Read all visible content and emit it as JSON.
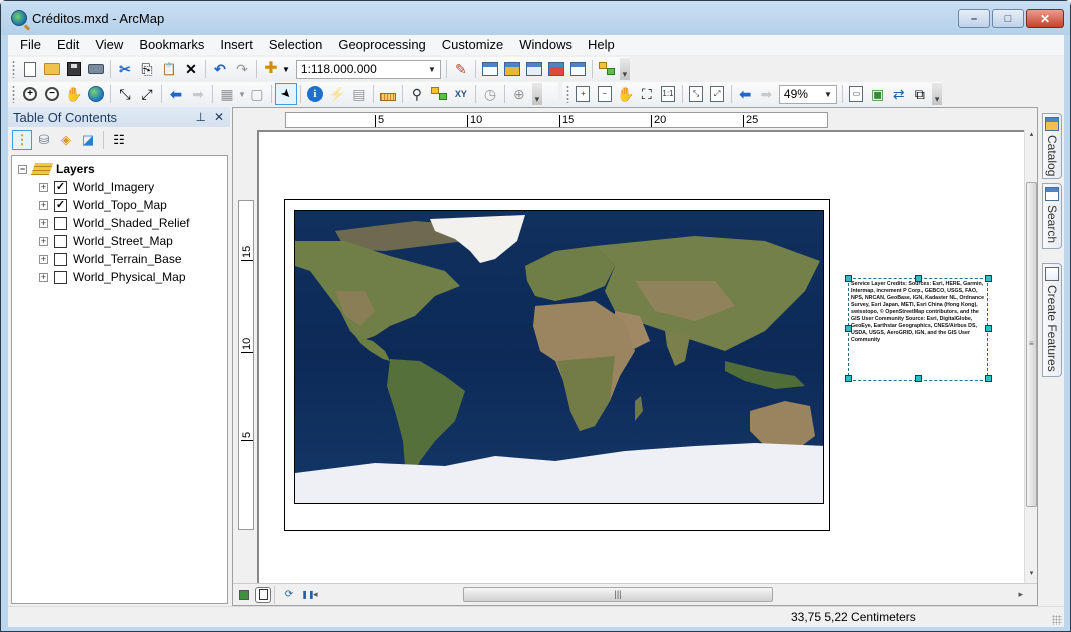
{
  "window": {
    "title": "Créditos.mxd - ArcMap",
    "controls": {
      "minimize": "–",
      "maximize": "□",
      "close": "✕"
    }
  },
  "menu": [
    "File",
    "Edit",
    "View",
    "Bookmarks",
    "Insert",
    "Selection",
    "Geoprocessing",
    "Customize",
    "Windows",
    "Help"
  ],
  "standard_toolbar": {
    "buttons": [
      {
        "name": "new-document",
        "icon": "new-document-icon"
      },
      {
        "name": "open",
        "icon": "open-folder-icon"
      },
      {
        "name": "save",
        "icon": "save-icon"
      },
      {
        "name": "print",
        "icon": "print-icon"
      },
      {
        "name": "cut",
        "icon": "scissors-icon",
        "glyph": "✂"
      },
      {
        "name": "copy",
        "icon": "copy-icon",
        "glyph": "⎘"
      },
      {
        "name": "paste",
        "icon": "paste-icon",
        "glyph": "📋"
      },
      {
        "name": "delete",
        "icon": "delete-icon",
        "glyph": "✕"
      },
      {
        "name": "undo",
        "icon": "undo-icon",
        "glyph": "↶"
      },
      {
        "name": "redo",
        "icon": "redo-icon",
        "glyph": "↷"
      },
      {
        "name": "add-data",
        "icon": "add-data-icon",
        "glyph": "✚"
      }
    ],
    "scale": "1:118.000.000",
    "right_buttons": [
      {
        "name": "editor-toolbar",
        "icon": "editor-pencil-icon",
        "glyph": "✎"
      },
      {
        "name": "table-of-contents",
        "icon": "toc-window-icon"
      },
      {
        "name": "catalog-window",
        "icon": "catalog-window-icon"
      },
      {
        "name": "search-window",
        "icon": "search-window-icon"
      },
      {
        "name": "arctoolbox",
        "icon": "arctoolbox-icon"
      },
      {
        "name": "python-window",
        "icon": "python-window-icon",
        "glyph": "›"
      },
      {
        "name": "modelbuilder",
        "icon": "modelbuilder-icon"
      }
    ]
  },
  "tools_toolbar": {
    "buttons": [
      {
        "name": "zoom-in",
        "icon": "zoom-in-icon",
        "glyph": "+"
      },
      {
        "name": "zoom-out",
        "icon": "zoom-out-icon",
        "glyph": "−"
      },
      {
        "name": "pan",
        "icon": "pan-hand-icon",
        "glyph": "✋"
      },
      {
        "name": "full-extent",
        "icon": "globe-icon"
      },
      {
        "name": "fixed-zoom-in",
        "icon": "fixed-zoom-in-icon",
        "glyph": "⤡"
      },
      {
        "name": "fixed-zoom-out",
        "icon": "fixed-zoom-out-icon",
        "glyph": "⤢"
      },
      {
        "name": "back-extent",
        "icon": "back-arrow-icon",
        "glyph": "⬅"
      },
      {
        "name": "forward-extent",
        "icon": "forward-arrow-icon",
        "glyph": "➡"
      },
      {
        "name": "select-features",
        "icon": "select-features-icon",
        "glyph": "▦"
      },
      {
        "name": "clear-selection",
        "icon": "clear-selection-icon",
        "glyph": "▢"
      },
      {
        "name": "select-elements",
        "icon": "select-arrow-icon",
        "glyph": "➤"
      },
      {
        "name": "identify",
        "icon": "info-icon",
        "glyph": "i"
      },
      {
        "name": "hyperlink",
        "icon": "lightning-icon",
        "glyph": "⚡"
      },
      {
        "name": "html-popup",
        "icon": "popup-icon",
        "glyph": "▤"
      },
      {
        "name": "measure",
        "icon": "ruler-icon"
      },
      {
        "name": "find",
        "icon": "binoculars-icon",
        "glyph": "🔭"
      },
      {
        "name": "find-route",
        "icon": "route-icon"
      },
      {
        "name": "go-to-xy",
        "icon": "xy-icon",
        "glyph": "XY"
      },
      {
        "name": "time-slider",
        "icon": "time-slider-icon",
        "glyph": "◷"
      },
      {
        "name": "create-viewer",
        "icon": "viewer-window-icon",
        "glyph": "⊕"
      }
    ]
  },
  "layout_toolbar": {
    "buttons": [
      {
        "name": "layout-zoom-in",
        "icon": "layout-zoom-in-icon",
        "glyph": "+"
      },
      {
        "name": "layout-zoom-out",
        "icon": "layout-zoom-out-icon",
        "glyph": "−"
      },
      {
        "name": "layout-pan",
        "icon": "layout-pan-icon",
        "glyph": "✋"
      },
      {
        "name": "zoom-whole-page",
        "icon": "whole-page-icon",
        "glyph": "⛶"
      },
      {
        "name": "zoom-100",
        "icon": "zoom-100-icon",
        "glyph": "1:1"
      },
      {
        "name": "fixed-zoom-in-layout",
        "icon": "layout-fixed-zoom-in-icon",
        "glyph": "⤡"
      },
      {
        "name": "fixed-zoom-out-layout",
        "icon": "layout-fixed-zoom-out-icon",
        "glyph": "⤢"
      },
      {
        "name": "layout-back",
        "icon": "layout-back-icon",
        "glyph": "⬅"
      },
      {
        "name": "layout-forward",
        "icon": "layout-forward-icon",
        "glyph": "➡"
      }
    ],
    "zoom": "49%",
    "right_buttons": [
      {
        "name": "toggle-draft-mode",
        "icon": "draft-mode-icon",
        "glyph": "▭"
      },
      {
        "name": "focus-data-frame",
        "icon": "focus-data-frame-icon",
        "glyph": "▣"
      },
      {
        "name": "change-layout",
        "icon": "change-layout-icon",
        "glyph": "⇄"
      },
      {
        "name": "data-driven-pages",
        "icon": "data-driven-pages-icon",
        "glyph": "⧉"
      }
    ]
  },
  "toc": {
    "title": "Table Of Contents",
    "pin": "⊥",
    "close": "✕",
    "tools": [
      {
        "name": "list-by-drawing-order",
        "icon": "list-by-drawing-order-icon",
        "glyph": "⋮"
      },
      {
        "name": "list-by-source",
        "icon": "list-by-source-icon",
        "glyph": "⛁"
      },
      {
        "name": "list-by-visibility",
        "icon": "list-by-visibility-icon",
        "glyph": "◈"
      },
      {
        "name": "list-by-selection",
        "icon": "list-by-selection-icon",
        "glyph": "◪"
      },
      {
        "name": "options",
        "icon": "options-icon",
        "glyph": "☷"
      }
    ],
    "group": {
      "label": "Layers",
      "expanded": true
    },
    "layers": [
      {
        "label": "World_Imagery",
        "checked": true
      },
      {
        "label": "World_Topo_Map",
        "checked": true
      },
      {
        "label": "World_Shaded_Relief",
        "checked": false
      },
      {
        "label": "World_Street_Map",
        "checked": false
      },
      {
        "label": "World_Terrain_Base",
        "checked": false
      },
      {
        "label": "World_Physical_Map",
        "checked": false
      }
    ]
  },
  "layout_view": {
    "hruler_ticks": [
      "5",
      "10",
      "15",
      "20",
      "25"
    ],
    "vruler_ticks": [
      "15",
      "10",
      "5"
    ],
    "credits_text": "Service Layer Credits: Sources: Esri, HERE, Garmin, Intermap, increment P Corp., GEBCO, USGS, FAO, NPS, NRCAN, GeoBase, IGN, Kadaster NL, Ordnance Survey, Esri Japan, METI, Esri China (Hong Kong), swisstopo, © OpenStreetMap contributors, and the GIS User Community Source: Esri, DigitalGlobe, GeoEye, Earthstar Geographics, CNES/Airbus DS, USDA, USGS, AeroGRID, IGN, and the GIS User Community",
    "bottom_controls": {
      "data_view": "data-view-icon",
      "layout_view": "layout-view-icon",
      "refresh": "⟳",
      "pause": "❚❚",
      "scroll_left": "◂",
      "scroll_right": "▸",
      "thumb_grip": "|||"
    },
    "vscroll": {
      "up": "▴",
      "down": "▾",
      "grip": "≡"
    }
  },
  "dock": [
    {
      "label": "Catalog",
      "icon": "catalog-icon"
    },
    {
      "label": "Search",
      "icon": "search-window-icon"
    },
    {
      "label": "Create Features",
      "icon": "create-features-icon"
    }
  ],
  "status": {
    "coordinates": "33,75  5,22 Centimeters"
  },
  "colors": {
    "title_bar": "#bcd6ee",
    "ocean": "#0c2b5a",
    "land": "#6b7a45",
    "ice": "#eef0f5",
    "selection_handle": "#2bc0c5",
    "highlight_border": "#3d9be0"
  }
}
